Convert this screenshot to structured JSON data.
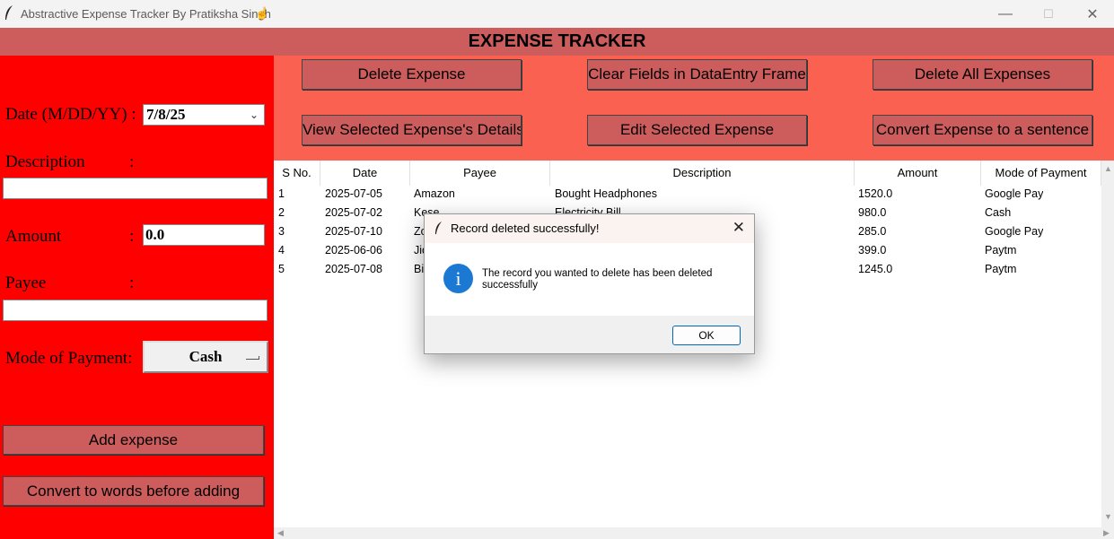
{
  "window": {
    "title": "Abstractive Expense Tracker By Pratiksha Singh",
    "title_icon": "feather-icon",
    "hand_glyph": "☝",
    "minimize_glyph": "—",
    "maximize_glyph": "☐",
    "close_glyph": "✕"
  },
  "header": {
    "title": "EXPENSE TRACKER"
  },
  "form": {
    "date_label": "Date (M/DD/YY) :",
    "date_value": "7/8/25",
    "description_label": "Description",
    "description_colon": ":",
    "description_value": "",
    "amount_label": "Amount",
    "amount_colon": ":",
    "amount_value": "0.0",
    "payee_label": "Payee",
    "payee_colon": ":",
    "payee_value": "",
    "mode_label": "Mode of Payment:",
    "mode_value": "Cash",
    "add_button": "Add expense",
    "convert_button": "Convert to words before adding"
  },
  "toolbar": {
    "delete": "Delete Expense",
    "clear": "Clear Fields in DataEntry Frame",
    "delete_all": "Delete All Expenses",
    "view": "View Selected Expense's Details",
    "edit": "Edit Selected Expense",
    "convert": "Convert Expense to a sentence"
  },
  "table": {
    "headers": [
      "S No.",
      "Date",
      "Payee",
      "Description",
      "Amount",
      "Mode of Payment"
    ],
    "rows": [
      [
        "1",
        "2025-07-05",
        "Amazon",
        "Bought Headphones",
        "1520.0",
        "Google Pay"
      ],
      [
        "2",
        "2025-07-02",
        "Kese",
        "Electricity Bill",
        "980.0",
        "Cash"
      ],
      [
        "3",
        "2025-07-10",
        "Zo",
        "",
        "285.0",
        "Google Pay"
      ],
      [
        "4",
        "2025-06-06",
        "Jio",
        "",
        "399.0",
        "Paytm"
      ],
      [
        "5",
        "2025-07-08",
        "Bi",
        "",
        "1245.0",
        "Paytm"
      ]
    ]
  },
  "dialog": {
    "title": "Record deleted successfully!",
    "message": "The record you wanted to delete has been deleted successfully",
    "icon": "info-icon",
    "icon_glyph": "i",
    "ok": "OK",
    "close_glyph": "✕"
  },
  "colors": {
    "header": "#cd5c5c",
    "left_panel": "#ff0000",
    "toolbar_panel": "#fa6150",
    "button": "#cd5c5c",
    "info": "#1b79d4"
  }
}
